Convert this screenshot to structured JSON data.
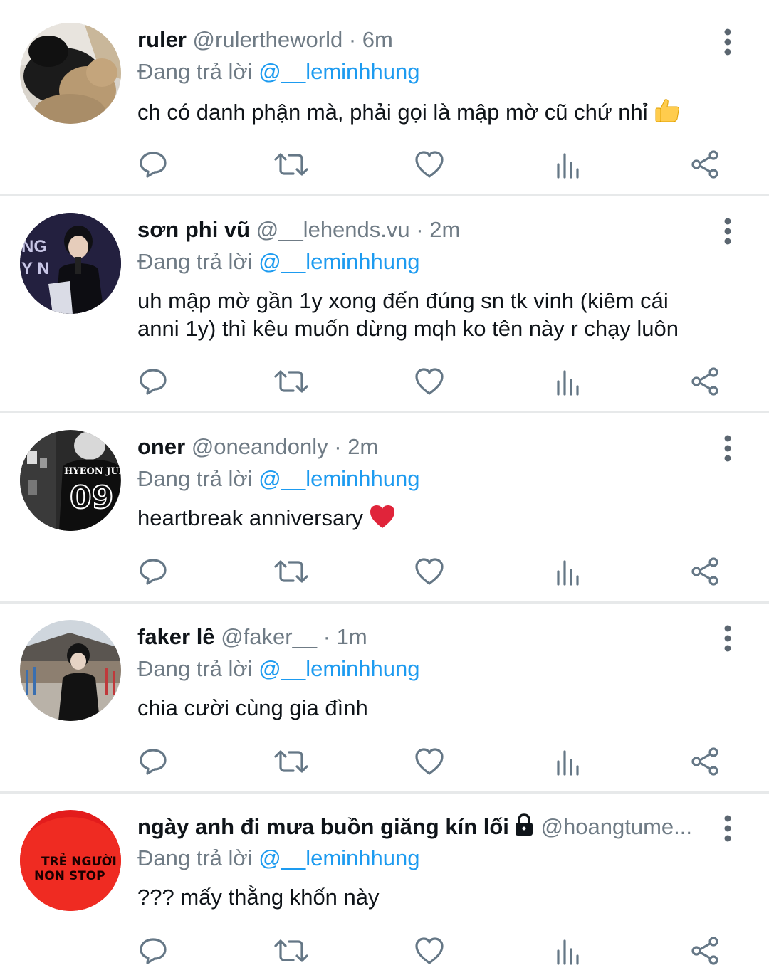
{
  "reply_prefix": "Đang trả lời",
  "tweets": [
    {
      "name": "ruler",
      "handle": "@rulertheworld",
      "time": "6m",
      "reply_to": "@__leminhhung",
      "text": "ch có danh phận mà, phải gọi là mập mờ cũ chứ nhỉ",
      "emoji": "thumbs-up"
    },
    {
      "name": "sơn phi vũ",
      "handle": "@__lehends.vu",
      "time": "2m",
      "reply_to": "@__leminhhung",
      "text": "uh mập mờ gần 1y xong đến đúng sn tk vinh (kiêm cái anni 1y) thì kêu muốn dừng mqh ko tên này r chạy luôn"
    },
    {
      "name": "oner",
      "handle": "@oneandonly",
      "time": "2m",
      "reply_to": "@__leminhhung",
      "text": "heartbreak anniversary",
      "emoji": "red-heart",
      "avatar_text": [
        "HYEON JUN",
        "09"
      ]
    },
    {
      "name": "faker lê",
      "handle": "@faker__",
      "time": "1m",
      "reply_to": "@__leminhhung",
      "text": "chia cười cùng gia đình"
    },
    {
      "name": "ngày anh đi mưa buồn giăng kín lối",
      "handle": "@hoangtume...",
      "time": "",
      "reply_to": "@__leminhhung",
      "text": "??? mấy thằng khốn này",
      "locked": true,
      "avatar_text": [
        "TRẺ NGƯỜI",
        "NON STOP"
      ]
    }
  ],
  "colors": {
    "text": "#0f1419",
    "secondary": "#6f7b85",
    "mention": "#1d9bf0",
    "divider": "#e7e9ea",
    "icon": "#657786"
  },
  "icons": [
    "reply-icon",
    "retweet-icon",
    "like-icon",
    "analytics-icon",
    "share-icon",
    "more-icon",
    "lock-icon"
  ]
}
